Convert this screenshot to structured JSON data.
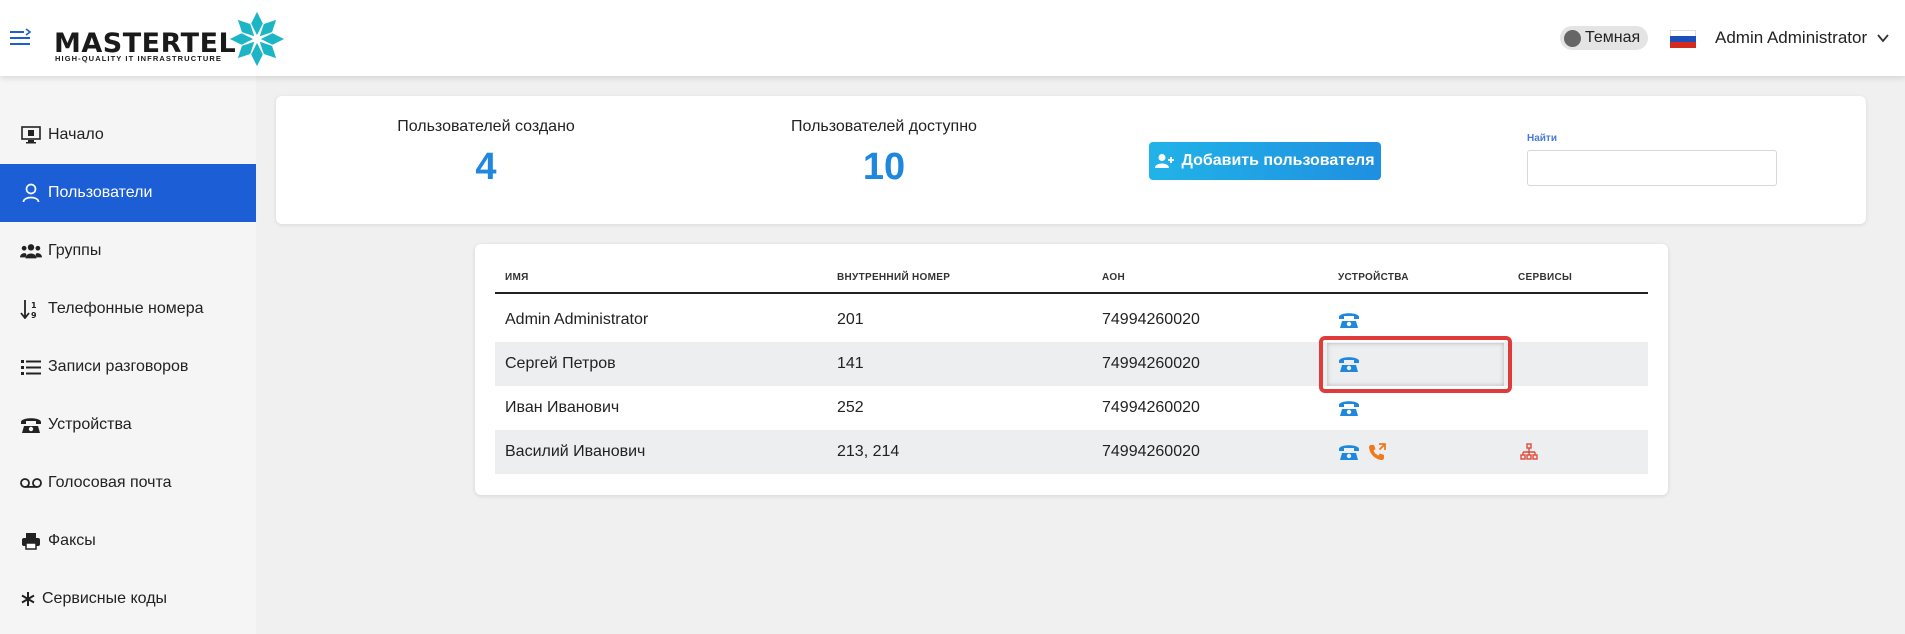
{
  "header": {
    "logo_text_main": "MASTERTEL",
    "logo_subtitle": "HIGH-QUALITY IT INFRASTRUCTURE",
    "theme_toggle_label": "Темная",
    "user_name": "Admin Administrator",
    "colors": {
      "logo_accent": "#1bb5c5"
    }
  },
  "sidebar": {
    "items": [
      {
        "label": "Начало",
        "icon": "monitor-icon",
        "active": false
      },
      {
        "label": "Пользователи",
        "icon": "user-icon",
        "active": true
      },
      {
        "label": "Группы",
        "icon": "users-group-icon",
        "active": false
      },
      {
        "label": "Телефонные номера",
        "icon": "sort-numbers-icon",
        "active": false
      },
      {
        "label": "Записи разговоров",
        "icon": "list-icon",
        "active": false
      },
      {
        "label": "Устройства",
        "icon": "phone-icon",
        "active": false
      },
      {
        "label": "Голосовая почта",
        "icon": "voicemail-icon",
        "active": false
      },
      {
        "label": "Факсы",
        "icon": "printer-icon",
        "active": false
      },
      {
        "label": "Сервисные коды",
        "icon": "asterisk-icon",
        "active": false
      }
    ],
    "colors": {
      "active_bg": "#1c5ed6"
    }
  },
  "stats": {
    "created_label": "Пользователей создано",
    "created_value": "4",
    "available_label": "Пользователей доступно",
    "available_value": "10",
    "add_button_label": "Добавить пользователя",
    "search_label": "Найти",
    "search_value": ""
  },
  "table": {
    "columns": [
      "ИМЯ",
      "ВНУТРЕННИЙ НОМЕР",
      "АОН",
      "УСТРОЙСТВА",
      "СЕРВИСЫ"
    ],
    "rows": [
      {
        "name": "Admin Administrator",
        "extension": "201",
        "aon": "74994260020",
        "devices": [
          "desk-phone-icon"
        ],
        "services": []
      },
      {
        "name": "Сергей Петров",
        "extension": "141",
        "aon": "74994260020",
        "devices": [
          "desk-phone-icon"
        ],
        "services": []
      },
      {
        "name": "Иван Иванович",
        "extension": "252",
        "aon": "74994260020",
        "devices": [
          "desk-phone-icon"
        ],
        "services": []
      },
      {
        "name": "Василий Иванович",
        "extension": "213, 214",
        "aon": "74994260020",
        "devices": [
          "desk-phone-icon",
          "call-forward-icon"
        ],
        "services": [
          "sitemap-icon"
        ]
      }
    ],
    "colors": {
      "device_icon": "#1f87de",
      "forward_icon": "#f07a1a",
      "service_icon": "#e24a3b",
      "highlight": "#e03b3b"
    }
  }
}
